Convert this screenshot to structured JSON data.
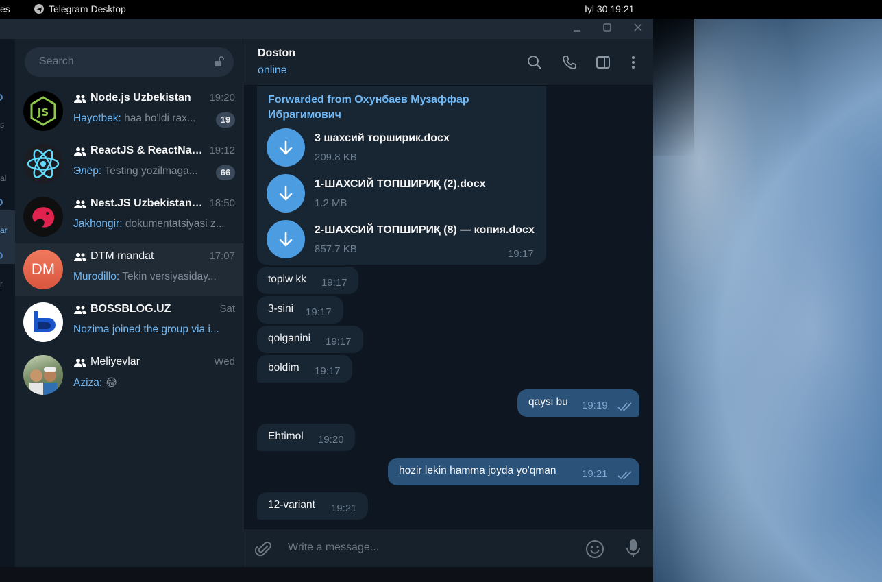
{
  "system_bar": {
    "activities": "es",
    "app_name": "Telegram Desktop",
    "clock": "Iyl 30  19:21"
  },
  "window": {
    "min_icon": "minimize-icon",
    "max_icon": "maximize-icon",
    "close_icon": "close-icon"
  },
  "rail": {
    "items": [
      "s",
      "al",
      "ar",
      "r"
    ]
  },
  "search": {
    "placeholder": "Search",
    "icon": "lock-open-icon"
  },
  "chats": [
    {
      "name": "Node.js Uzbekistan",
      "time": "19:20",
      "sender": "Hayotbek:",
      "preview": "haa bo'ldi rax...",
      "badge": "19",
      "avatar": "nodejs-logo",
      "avatar_bg": "#000000"
    },
    {
      "name": "ReactJS & ReactNat...",
      "time": "19:12",
      "sender": "Элёр:",
      "preview": "Testing yozilmaga...",
      "badge": "66",
      "avatar": "react-logo",
      "avatar_bg": "#1b1d23"
    },
    {
      "name": "Nest.JS Uzbekistan ...",
      "time": "18:50",
      "sender": "Jakhongir:",
      "preview": "dokumentatsiyasi z...",
      "badge": "",
      "avatar": "nestjs-logo",
      "avatar_bg": "#0f0f10"
    },
    {
      "name": "DTM mandat",
      "time": "17:07",
      "sender": "Murodillo:",
      "preview": "Tekin versiyasiday...",
      "badge": "",
      "avatar": "DM",
      "avatar_bg": "#e5684d"
    },
    {
      "name": "BOSSBLOG.UZ",
      "time": "Sat",
      "sender": "",
      "preview": "Nozima joined the group via i...",
      "badge": "",
      "avatar": "bossblog-logo",
      "avatar_bg": "#ffffff"
    },
    {
      "name": "Meliyevlar",
      "time": "Wed",
      "sender": "Aziza:",
      "preview": "😂",
      "badge": "",
      "avatar": "photo",
      "avatar_bg": "#7a8f6a"
    }
  ],
  "header": {
    "peer_name": "Doston",
    "peer_status": "online"
  },
  "forwarded": {
    "label": "Forwarded from Охунбаев Музаффар Ибрагимович",
    "time": "19:17",
    "files": [
      {
        "name": "3 шахсий торширик.docx",
        "size": "209.8 KB"
      },
      {
        "name": "1-ШАХСИЙ ТОПШИРИҚ (2).docx",
        "size": "1.2 MB"
      },
      {
        "name": "2-ШАХСИЙ ТОПШИРИҚ (8) — копия.docx",
        "size": "857.7 KB"
      }
    ]
  },
  "messages": [
    {
      "text": "topiw kk",
      "time": "19:17",
      "out": false
    },
    {
      "text": "3-sini",
      "time": "19:17",
      "out": false
    },
    {
      "text": "qolganini",
      "time": "19:17",
      "out": false
    },
    {
      "text": "boldim",
      "time": "19:17",
      "out": false
    },
    {
      "text": "qaysi bu",
      "time": "19:19",
      "out": true
    },
    {
      "text": "Ehtimol",
      "time": "19:20",
      "out": false
    },
    {
      "text": "hozir lekin hamma joyda yo'qman",
      "time": "19:21",
      "out": true
    },
    {
      "text": "12-variant",
      "time": "19:21",
      "out": false
    }
  ],
  "composer": {
    "placeholder": "Write a message...",
    "attach_icon": "paperclip-icon",
    "emoji_icon": "smile-icon",
    "mic_icon": "microphone-icon"
  },
  "colors": {
    "accent": "#71b9f5",
    "outgoing_bubble": "#2b5278",
    "incoming_bubble": "#182533",
    "download_button": "#4c9ce2"
  }
}
